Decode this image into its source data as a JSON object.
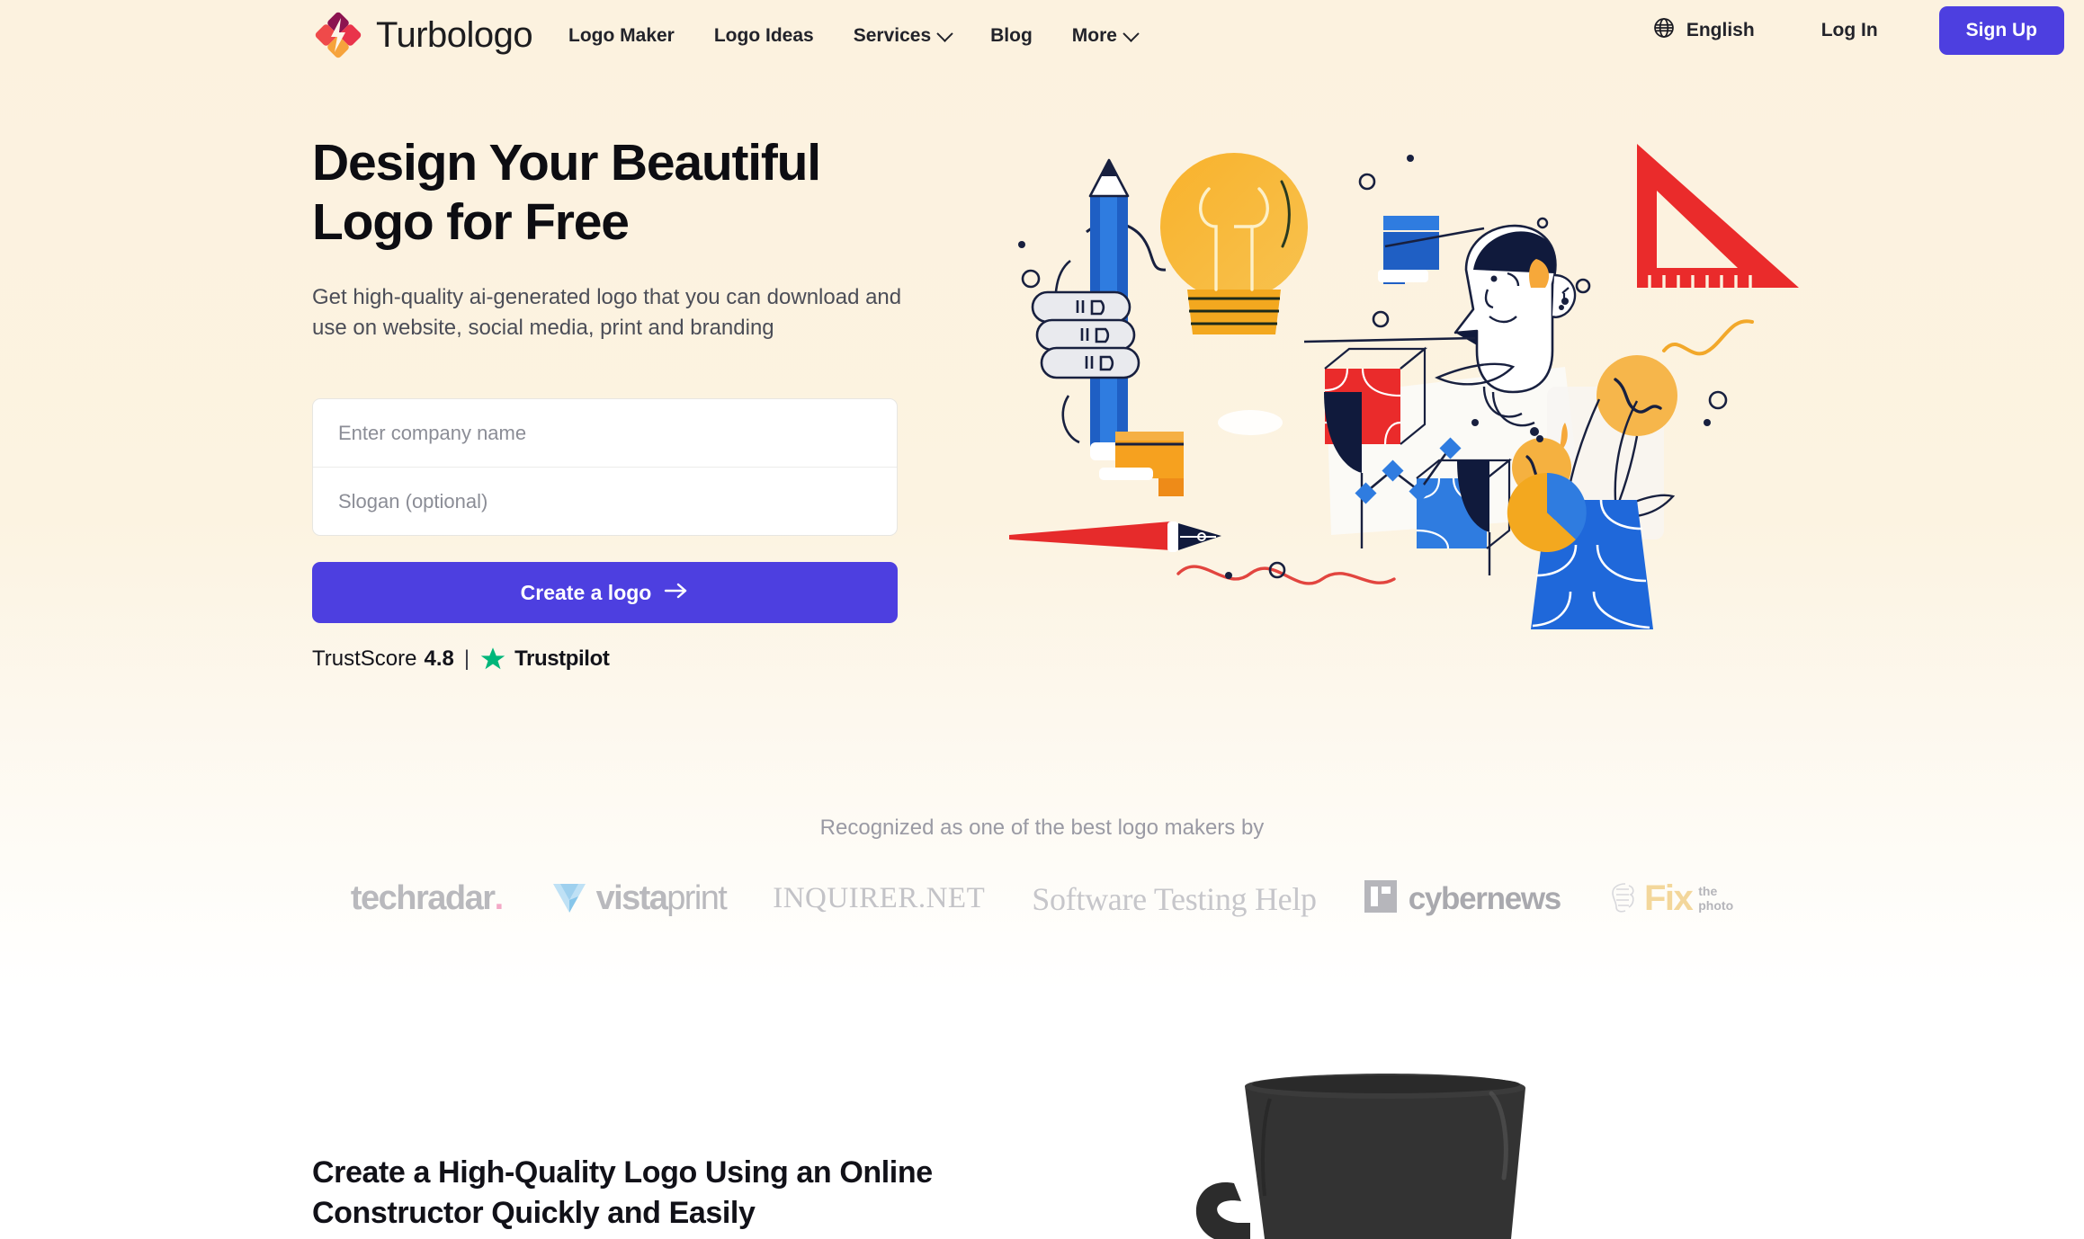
{
  "brand": {
    "name": "Turbologo",
    "logo_icon": "turbologo-diamond-icon",
    "colors": {
      "mark_top": "#8c1350",
      "mark_left": "#ef3b45",
      "mark_right": "#f4683a",
      "mark_bottom": "#f9b43f",
      "accent": "#4d3fe0"
    }
  },
  "nav": {
    "items": [
      {
        "label": "Logo Maker",
        "has_dropdown": false
      },
      {
        "label": "Logo Ideas",
        "has_dropdown": false
      },
      {
        "label": "Services",
        "has_dropdown": true
      },
      {
        "label": "Blog",
        "has_dropdown": false
      },
      {
        "label": "More",
        "has_dropdown": true
      }
    ],
    "language": {
      "label": "English",
      "icon": "globe-icon"
    },
    "login_label": "Log In",
    "signup_label": "Sign Up"
  },
  "hero": {
    "title": "Design Your Beautiful\nLogo for Free",
    "subtitle": "Get high-quality ai-generated logo that you can download and\nuse on website, social media, print and branding",
    "form": {
      "company_placeholder": "Enter company name",
      "company_value": "",
      "slogan_placeholder": "Slogan (optional)",
      "slogan_value": ""
    },
    "cta_label": "Create a logo",
    "cta_icon": "arrow-right-icon",
    "trust": {
      "label": "TrustScore",
      "score": "4.8",
      "separator": "|",
      "star_icon": "star-icon",
      "star_color": "#00b67a",
      "platform": "Trustpilot"
    },
    "illustration": "creative-design-tools-illustration"
  },
  "recognition": {
    "heading": "Recognized as one of the best logo makers by",
    "logos": [
      {
        "name": "techradar",
        "text": "techradar",
        "dot": "."
      },
      {
        "name": "vistaprint",
        "bold": "vista",
        "light": "print",
        "reg": "®"
      },
      {
        "name": "inquirer-net",
        "text": "INQUIRER.NET"
      },
      {
        "name": "software-testing-help",
        "text": "Software Testing Help"
      },
      {
        "name": "cybernews",
        "text": "cybernews"
      },
      {
        "name": "fixthephoto",
        "text": "Fix",
        "line1": "the",
        "line2": "photo"
      }
    ]
  },
  "section2": {
    "title": "Create a High-Quality Logo Using an Online\nConstructor Quickly and Easily",
    "image": "black-coffee-mug-photo"
  }
}
